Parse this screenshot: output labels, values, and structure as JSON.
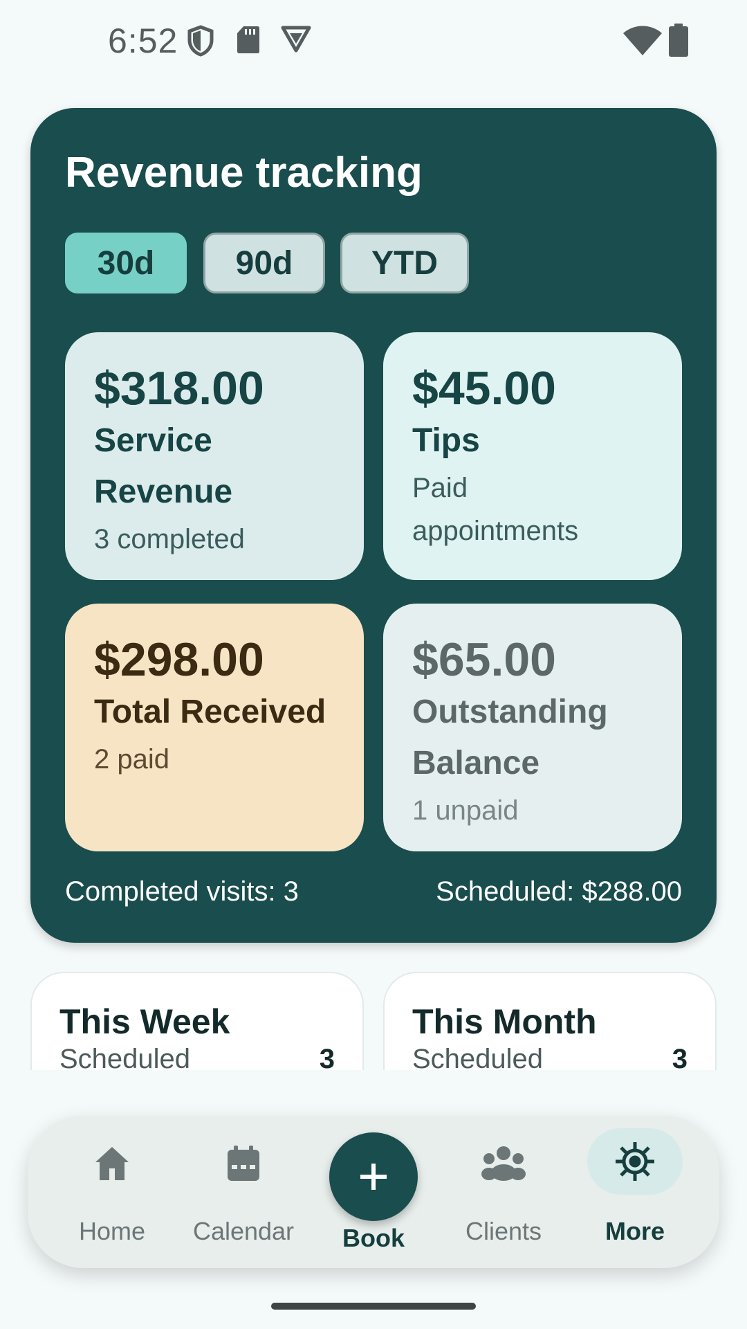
{
  "status_bar": {
    "time": "6:52",
    "left_icons": [
      "shield-icon",
      "sd-card-icon",
      "vpn-icon"
    ],
    "right_icons": [
      "wifi-icon",
      "battery-icon"
    ]
  },
  "revenue": {
    "title": "Revenue tracking",
    "ranges": [
      {
        "label": "30d",
        "selected": true
      },
      {
        "label": "90d",
        "selected": false
      },
      {
        "label": "YTD",
        "selected": false
      }
    ],
    "tiles": {
      "service": {
        "amount": "$318.00",
        "label_line1": "Service",
        "label_line2": "Revenue",
        "sub": "3 completed"
      },
      "tips": {
        "amount": "$45.00",
        "label": "Tips",
        "sub_line1": "Paid",
        "sub_line2": "appointments"
      },
      "received": {
        "amount": "$298.00",
        "label": "Total Received",
        "sub": "2 paid"
      },
      "outstanding": {
        "amount": "$65.00",
        "label_line1": "Outstanding",
        "label_line2": "Balance",
        "sub": "1 unpaid"
      }
    },
    "completed_visits": "Completed visits: 3",
    "scheduled_total": "Scheduled: $288.00"
  },
  "periods": {
    "week": {
      "title": "This Week",
      "label": "Scheduled",
      "count": "3"
    },
    "month": {
      "title": "This Month",
      "label": "Scheduled",
      "count": "3"
    }
  },
  "nav": {
    "items": [
      {
        "label": "Home",
        "icon": "home-icon"
      },
      {
        "label": "Calendar",
        "icon": "calendar-icon"
      },
      {
        "label": "Book",
        "icon": "plus-icon"
      },
      {
        "label": "Clients",
        "icon": "clients-icon"
      },
      {
        "label": "More",
        "icon": "settings-icon",
        "selected": true
      }
    ]
  },
  "colors": {
    "primary": "#1a4d4d",
    "accent_chip": "#77d0c5",
    "received_tile": "#f6e4c5"
  }
}
